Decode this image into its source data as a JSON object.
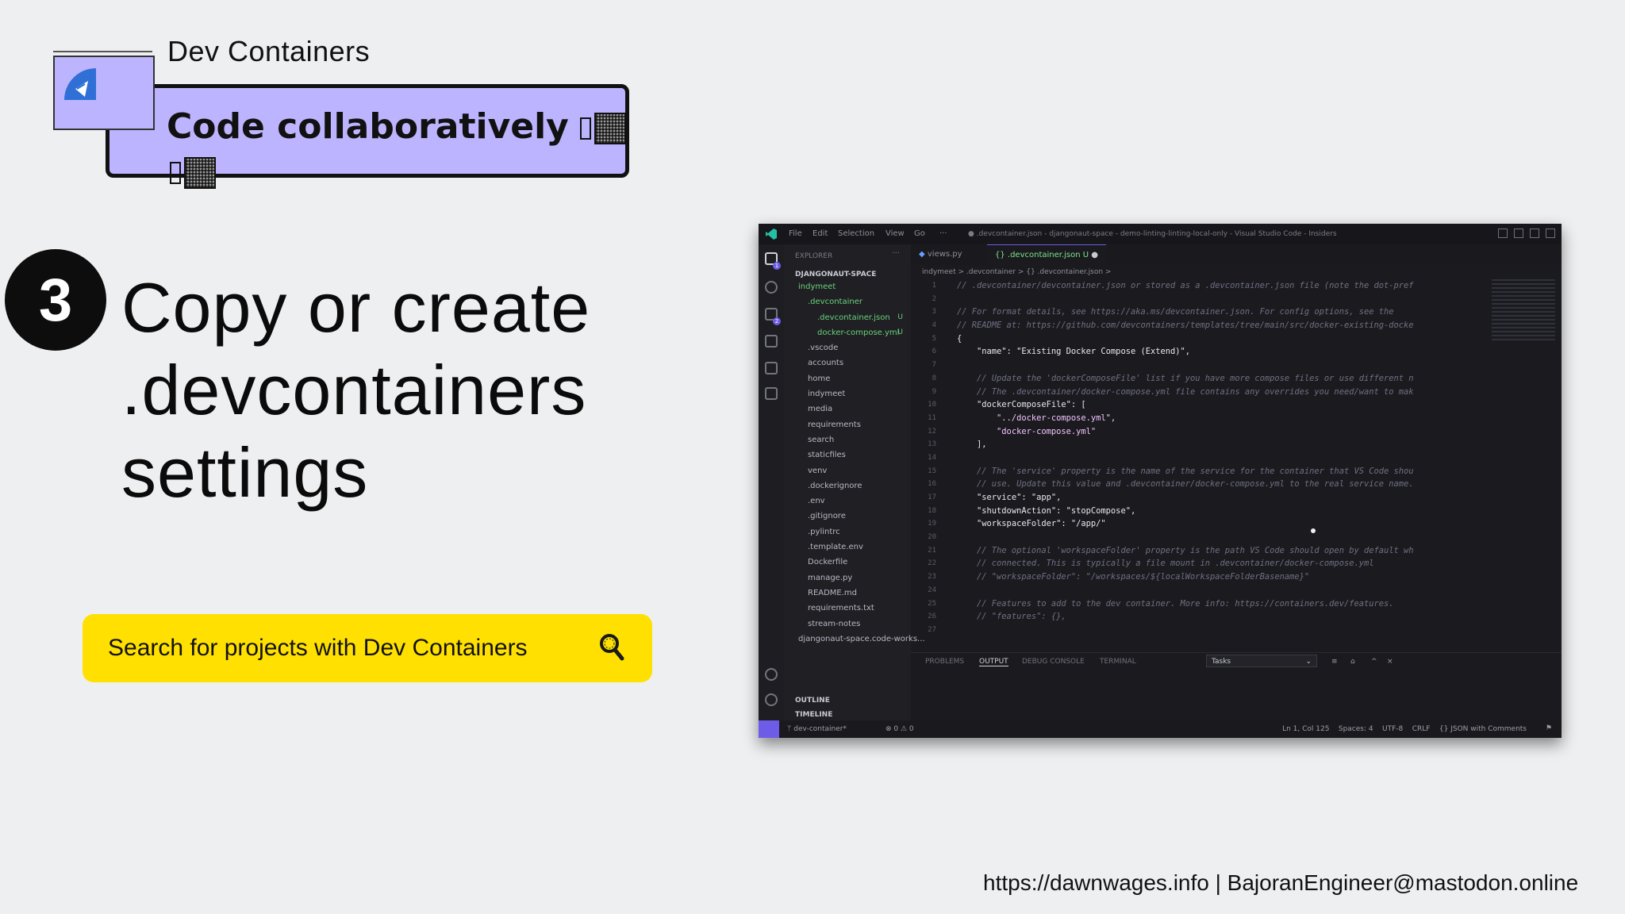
{
  "header": {
    "title": "Dev Containers",
    "badge_text": "Code collaboratively"
  },
  "step": {
    "number": "3",
    "title_lines": [
      "Copy or create",
      ".devcontainers",
      "settings"
    ]
  },
  "search": {
    "label": "Search for projects with Dev Containers",
    "icon": "search-icon"
  },
  "footer": {
    "text": "https://dawnwages.info | BajoranEngineer@mastodon.online"
  },
  "colors": {
    "badge_bg": "#bcb4ff",
    "search_bg": "#ffe000",
    "page_bg": "#eeeff1",
    "vscode_accent": "#6c5ce7"
  },
  "vscode": {
    "menu": [
      "File",
      "Edit",
      "Selection",
      "View",
      "Go",
      "···"
    ],
    "window_title": "● .devcontainer.json - djangonaut-space - demo-linting-linting-local-only - Visual Studio Code - Insiders",
    "sidebar": {
      "header": "EXPLORER",
      "root": "DJANGONAUT-SPACE",
      "tree": [
        {
          "label": "indymeet",
          "cls": "g"
        },
        {
          "label": ".devcontainer",
          "cls": "g"
        },
        {
          "label": ".devcontainer.json",
          "cls": "g",
          "mark": "U"
        },
        {
          "label": "docker-compose.yml",
          "cls": "g",
          "mark": "U"
        },
        {
          "label": ".vscode"
        },
        {
          "label": "accounts"
        },
        {
          "label": "home"
        },
        {
          "label": "indymeet"
        },
        {
          "label": "media"
        },
        {
          "label": "requirements"
        },
        {
          "label": "search"
        },
        {
          "label": "staticfiles"
        },
        {
          "label": "venv"
        },
        {
          "label": ".dockerignore"
        },
        {
          "label": ".env"
        },
        {
          "label": ".gitignore"
        },
        {
          "label": ".pylintrc"
        },
        {
          "label": ".template.env"
        },
        {
          "label": "Dockerfile"
        },
        {
          "label": "manage.py"
        },
        {
          "label": "README.md"
        },
        {
          "label": "requirements.txt"
        },
        {
          "label": "stream-notes"
        },
        {
          "label": "djangonaut-space.code-works..."
        }
      ],
      "outline": "OUTLINE",
      "timeline": "TIMELINE"
    },
    "tabs": [
      "views.py",
      ".devcontainer.json U"
    ],
    "breadcrumb": "indymeet > .devcontainer > {} .devcontainer.json >",
    "line_numbers": [
      "1",
      "2",
      "3",
      "4",
      "5",
      "6",
      "7",
      "8",
      "9",
      "10",
      "11",
      "12",
      "13",
      "14",
      "15",
      "16",
      "17",
      "18",
      "19",
      "20",
      "21",
      "22",
      "23",
      "24",
      "25",
      "26",
      "27"
    ],
    "code": [
      "// .devcontainer/devcontainer.json or stored as a .devcontainer.json file (note the dot-pref",
      "",
      "// For format details, see https://aka.ms/devcontainer.json. For config options, see the",
      "// README at: https://github.com/devcontainers/templates/tree/main/src/docker-existing-docke",
      "{",
      "    \"name\": \"Existing Docker Compose (Extend)\",",
      "",
      "    // Update the 'dockerComposeFile' list if you have more compose files or use different n",
      "    // The .devcontainer/docker-compose.yml file contains any overrides you need/want to mak",
      "    \"dockerComposeFile\": [",
      "        \"../docker-compose.yml\",",
      "        \"docker-compose.yml\"",
      "    ],",
      "",
      "    // The 'service' property is the name of the service for the container that VS Code shou",
      "    // use. Update this value and .devcontainer/docker-compose.yml to the real service name.",
      "    \"service\": \"app\",",
      "    \"shutdownAction\": \"stopCompose\",",
      "    \"workspaceFolder\": \"/app/\"",
      "",
      "    // The optional 'workspaceFolder' property is the path VS Code should open by default wh",
      "    // connected. This is typically a file mount in .devcontainer/docker-compose.yml",
      "    // \"workspaceFolder\": \"/workspaces/${localWorkspaceFolderBasename}\"",
      "",
      "    // Features to add to the dev container. More info: https://containers.dev/features.",
      "    // \"features\": {},",
      ""
    ],
    "panel_tabs": [
      "PROBLEMS",
      "OUTPUT",
      "DEBUG CONSOLE",
      "TERMINAL"
    ],
    "panel_select": "Tasks",
    "status_left": "dev-container*",
    "status_problems": "⊗ 0 ⚠ 0",
    "status_right": "Ln 1, Col 125    Spaces: 4    UTF-8    CRLF    {} JSON with Comments"
  }
}
